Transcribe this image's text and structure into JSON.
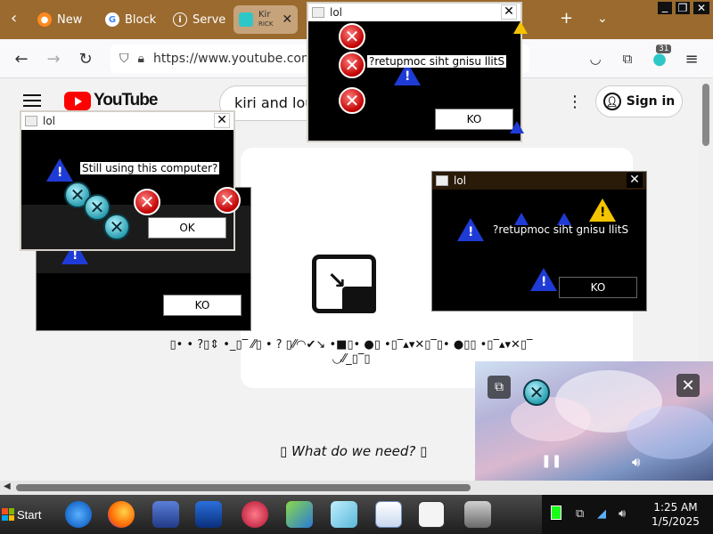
{
  "browser": {
    "tabs": [
      {
        "label": "New",
        "icon": "firefox-icon"
      },
      {
        "label": "Block",
        "icon": "google-icon"
      },
      {
        "label": "Server",
        "icon": "info-icon"
      },
      {
        "label": "Kir",
        "sublabel": "RICK",
        "icon": "youtube-tab-icon",
        "active": true
      }
    ],
    "url": "https://www.youtube.com/",
    "badge_count": "31"
  },
  "youtube": {
    "logo_text": "YouTube",
    "search_value": "kiri and lou",
    "sign_in_label": "Sign in",
    "glitch_line1": "▯• • ?▯⇕ •_▯‾ ⁄⁄▯ • ? ▯⁄⁄◠✔↘ •■▯• ●▯ •▯‾▴▾✕▯‾▯• ●▯▯ •▯‾▴▾✕▯‾",
    "glitch_line2": "◡⁄⁄_▯‾▯",
    "bottom_text": "▯ What do we need? ▯"
  },
  "dialogs": [
    {
      "id": "d1",
      "title": "lol",
      "message": "Still using this computer?",
      "button": "OK"
    },
    {
      "id": "d2",
      "title": "lol",
      "message": "",
      "button": "KO"
    },
    {
      "id": "d3",
      "title": "lol",
      "message": "?retupmoc siht gnisu llitS",
      "button": "KO"
    },
    {
      "id": "d4",
      "title": "lol",
      "message": "?retupmoc siht gnisu llitS",
      "button": "KO"
    }
  ],
  "taskbar": {
    "start_label": "Start",
    "time": "1:25 AM",
    "date": "1/5/2025"
  },
  "colors": {
    "tabbar": "#9a6a2e",
    "youtube_red": "#ff0000",
    "dialog_bg": "#000000"
  }
}
